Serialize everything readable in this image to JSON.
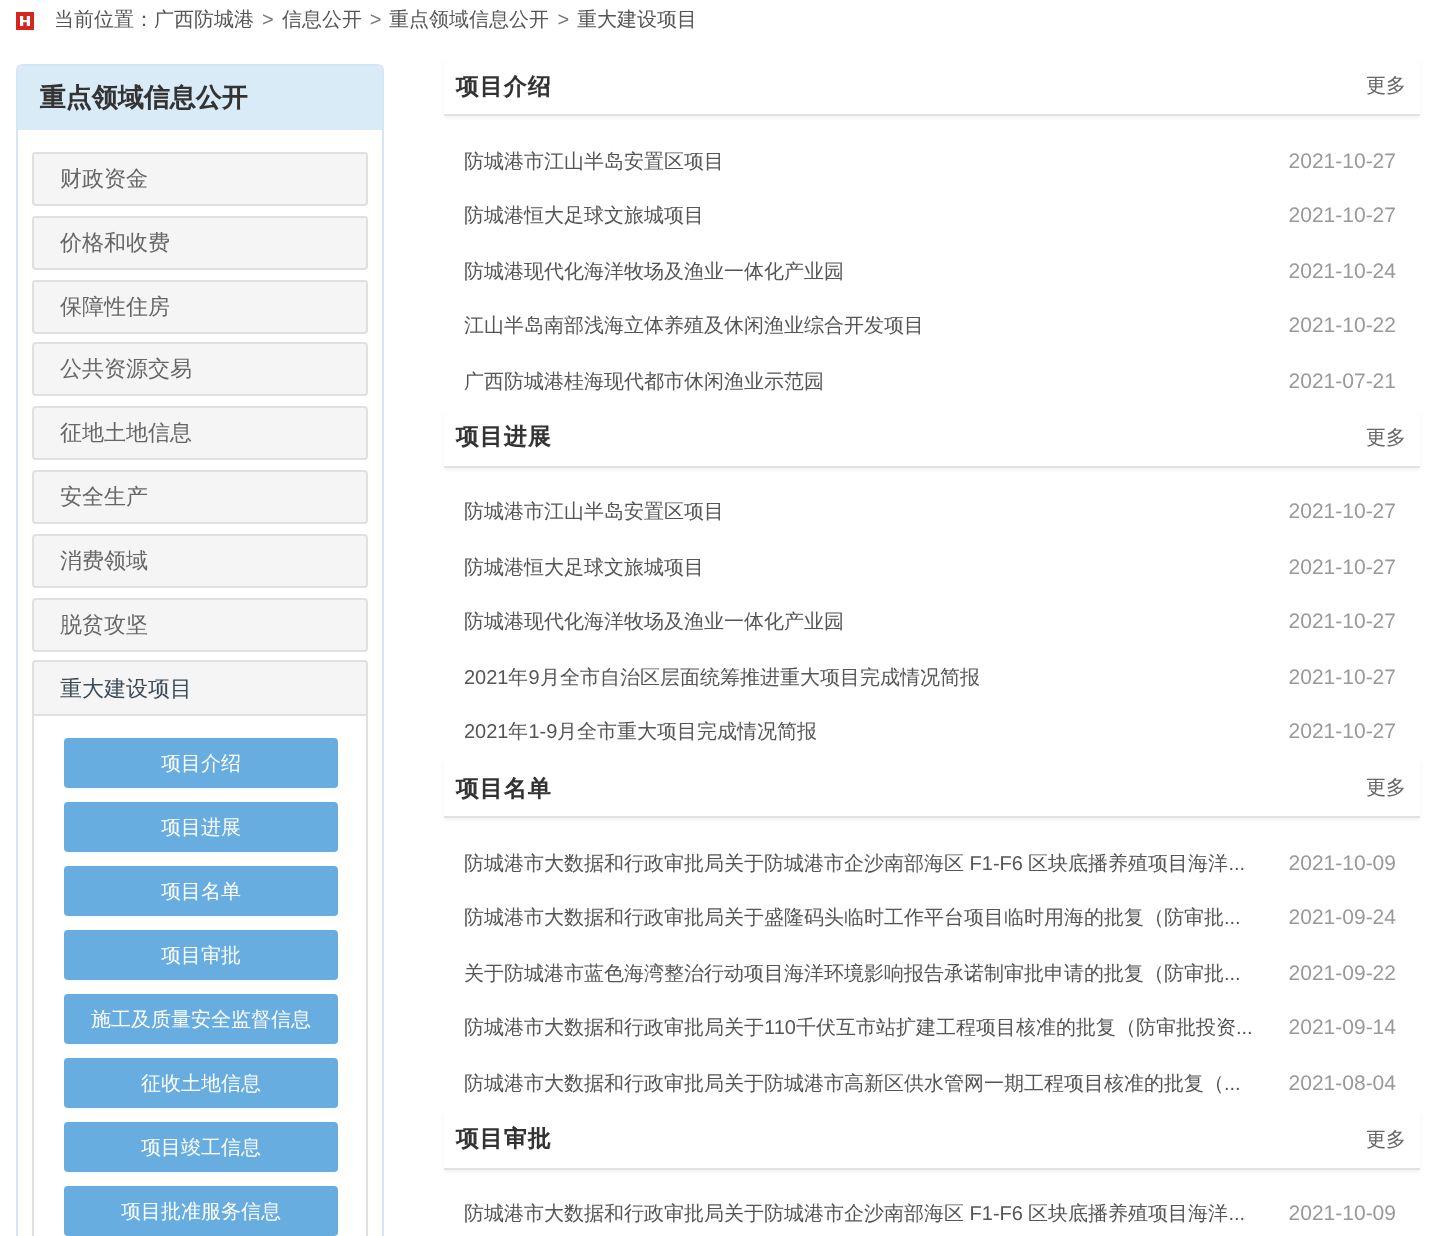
{
  "breadcrumb": {
    "label": "当前位置：",
    "items": [
      {
        "text": "广西防城港"
      },
      {
        "separator": ">",
        "text": "信息公开"
      },
      {
        "separator": ">",
        "text": "重点领域信息公开"
      },
      {
        "separator": ">",
        "text": "重大建设项目"
      }
    ]
  },
  "sidebar": {
    "title": "重点领域信息公开",
    "items": [
      {
        "label": "财政资金",
        "expanded": false
      },
      {
        "label": "价格和收费",
        "expanded": false
      },
      {
        "label": "保障性住房",
        "expanded": false
      },
      {
        "label": "公共资源交易",
        "expanded": false
      },
      {
        "label": "征地土地信息",
        "expanded": false
      },
      {
        "label": "安全生产",
        "expanded": false
      },
      {
        "label": "消费领域",
        "expanded": false
      },
      {
        "label": "脱贫攻坚",
        "expanded": false
      },
      {
        "label": "重大建设项目",
        "expanded": true,
        "children": [
          {
            "label": "项目介绍"
          },
          {
            "label": "项目进展"
          },
          {
            "label": "项目名单"
          },
          {
            "label": "项目审批"
          },
          {
            "label": "施工及质量安全监督信息"
          },
          {
            "label": "征收土地信息"
          },
          {
            "label": "项目竣工信息"
          },
          {
            "label": "项目批准服务信息"
          }
        ]
      }
    ]
  },
  "sections": [
    {
      "title": "项目介绍",
      "more": "更多",
      "rows": [
        {
          "title": "防城港市江山半岛安置区项目",
          "date": "2021-10-27"
        },
        {
          "title": "防城港恒大足球文旅城项目",
          "date": "2021-10-27"
        },
        {
          "title": "防城港现代化海洋牧场及渔业一体化产业园",
          "date": "2021-10-24"
        },
        {
          "title": "江山半岛南部浅海立体养殖及休闲渔业综合开发项目",
          "date": "2021-10-22"
        },
        {
          "title": "广西防城港桂海现代都市休闲渔业示范园",
          "date": "2021-07-21"
        }
      ]
    },
    {
      "title": "项目进展",
      "more": "更多",
      "rows": [
        {
          "title": "防城港市江山半岛安置区项目",
          "date": "2021-10-27"
        },
        {
          "title": "防城港恒大足球文旅城项目",
          "date": "2021-10-27"
        },
        {
          "title": "防城港现代化海洋牧场及渔业一体化产业园",
          "date": "2021-10-27"
        },
        {
          "title": "2021年9月全市自治区层面统筹推进重大项目完成情况简报",
          "date": "2021-10-27"
        },
        {
          "title": "2021年1-9月全市重大项目完成情况简报",
          "date": "2021-10-27"
        }
      ]
    },
    {
      "title": "项目名单",
      "more": "更多",
      "rows": [
        {
          "title": "防城港市大数据和行政审批局关于防城港市企沙南部海区 F1-F6 区块底播养殖项目海洋...",
          "date": "2021-10-09"
        },
        {
          "title": "防城港市大数据和行政审批局关于盛隆码头临时工作平台项目临时用海的批复（防审批...",
          "date": "2021-09-24"
        },
        {
          "title": "关于防城港市蓝色海湾整治行动项目海洋环境影响报告承诺制审批申请的批复（防审批...",
          "date": "2021-09-22"
        },
        {
          "title": "防城港市大数据和行政审批局关于110千伏互市站扩建工程项目核准的批复（防审批投资...",
          "date": "2021-09-14"
        },
        {
          "title": "防城港市大数据和行政审批局关于防城港市高新区供水管网一期工程项目核准的批复（...",
          "date": "2021-08-04"
        }
      ]
    },
    {
      "title": "项目审批",
      "more": "更多",
      "rows": [
        {
          "title": "防城港市大数据和行政审批局关于防城港市企沙南部海区 F1-F6 区块底播养殖项目海洋...",
          "date": "2021-10-09"
        }
      ]
    }
  ]
}
